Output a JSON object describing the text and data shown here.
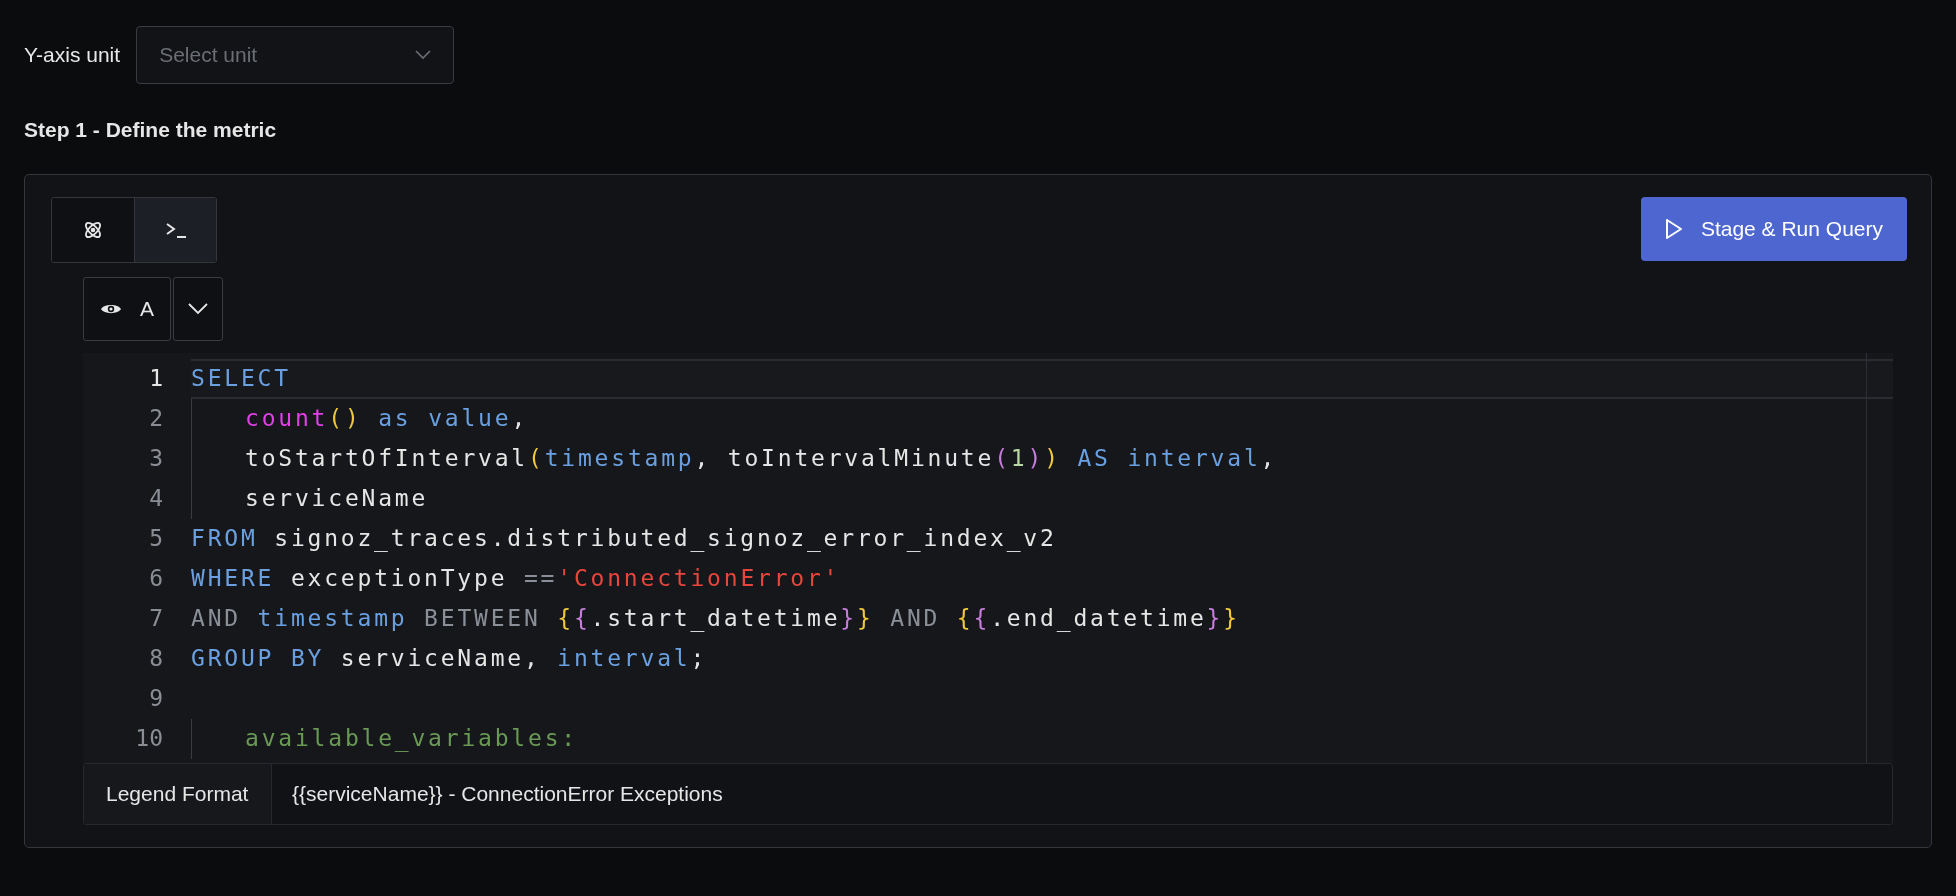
{
  "y_axis": {
    "label": "Y-axis unit",
    "placeholder": "Select unit"
  },
  "step_title": "Step 1 - Define the metric",
  "tabs": [
    {
      "selected": false
    },
    {
      "selected": true
    }
  ],
  "run_button": {
    "label": "Stage & Run Query"
  },
  "query": {
    "name": "A",
    "visible": true
  },
  "editor": {
    "lines": [
      {
        "number": "1",
        "active": true,
        "indented": false,
        "tokens": [
          {
            "kind": "keyword",
            "text": "SELECT"
          }
        ]
      },
      {
        "number": "2",
        "active": false,
        "indented": true,
        "tokens": [
          {
            "kind": "function",
            "text": "count"
          },
          {
            "kind": "paren1",
            "text": "()"
          },
          {
            "kind": "keyword",
            "text": " as"
          },
          {
            "kind": "keyword",
            "text": " value"
          },
          {
            "kind": "plain",
            "text": ","
          }
        ]
      },
      {
        "number": "3",
        "active": false,
        "indented": true,
        "tokens": [
          {
            "kind": "plain",
            "text": "toStartOfInterval"
          },
          {
            "kind": "paren1",
            "text": "("
          },
          {
            "kind": "keyword",
            "text": "timestamp"
          },
          {
            "kind": "plain",
            "text": ", toIntervalMinute"
          },
          {
            "kind": "paren2",
            "text": "("
          },
          {
            "kind": "number",
            "text": "1"
          },
          {
            "kind": "paren2",
            "text": ")"
          },
          {
            "kind": "paren1",
            "text": ")"
          },
          {
            "kind": "keyword",
            "text": " AS"
          },
          {
            "kind": "keyword",
            "text": " interval"
          },
          {
            "kind": "plain",
            "text": ","
          }
        ]
      },
      {
        "number": "4",
        "active": false,
        "indented": true,
        "tokens": [
          {
            "kind": "plain",
            "text": "serviceName"
          }
        ]
      },
      {
        "number": "5",
        "active": false,
        "indented": false,
        "tokens": [
          {
            "kind": "keyword",
            "text": "FROM"
          },
          {
            "kind": "plain",
            "text": " signoz_traces.distributed_signoz_error_index_v2"
          }
        ]
      },
      {
        "number": "6",
        "active": false,
        "indented": false,
        "tokens": [
          {
            "kind": "keyword",
            "text": "WHERE"
          },
          {
            "kind": "plain",
            "text": " exceptionType "
          },
          {
            "kind": "operator",
            "text": "=="
          },
          {
            "kind": "string",
            "text": "'ConnectionError'"
          }
        ]
      },
      {
        "number": "7",
        "active": false,
        "indented": false,
        "tokens": [
          {
            "kind": "operator",
            "text": "AND"
          },
          {
            "kind": "keyword",
            "text": " timestamp"
          },
          {
            "kind": "operator",
            "text": " BETWEEN"
          },
          {
            "kind": "paren1",
            "text": " {"
          },
          {
            "kind": "paren2",
            "text": "{"
          },
          {
            "kind": "plain",
            "text": ".start_datetime"
          },
          {
            "kind": "paren2",
            "text": "}"
          },
          {
            "kind": "paren1",
            "text": "}"
          },
          {
            "kind": "operator",
            "text": " AND"
          },
          {
            "kind": "paren1",
            "text": " {"
          },
          {
            "kind": "paren2",
            "text": "{"
          },
          {
            "kind": "plain",
            "text": ".end_datetime"
          },
          {
            "kind": "paren2",
            "text": "}"
          },
          {
            "kind": "paren1",
            "text": "}"
          }
        ]
      },
      {
        "number": "8",
        "active": false,
        "indented": false,
        "tokens": [
          {
            "kind": "keyword",
            "text": "GROUP BY"
          },
          {
            "kind": "plain",
            "text": " serviceName, "
          },
          {
            "kind": "keyword",
            "text": "interval"
          },
          {
            "kind": "plain",
            "text": ";"
          }
        ]
      },
      {
        "number": "9",
        "active": false
      },
      {
        "number": "10",
        "active": false,
        "indented": true,
        "tokens": [
          {
            "kind": "comment",
            "text": "available_variables:"
          }
        ]
      }
    ]
  },
  "legend": {
    "label": "Legend Format",
    "value": "{{serviceName}} - ConnectionError Exceptions"
  }
}
